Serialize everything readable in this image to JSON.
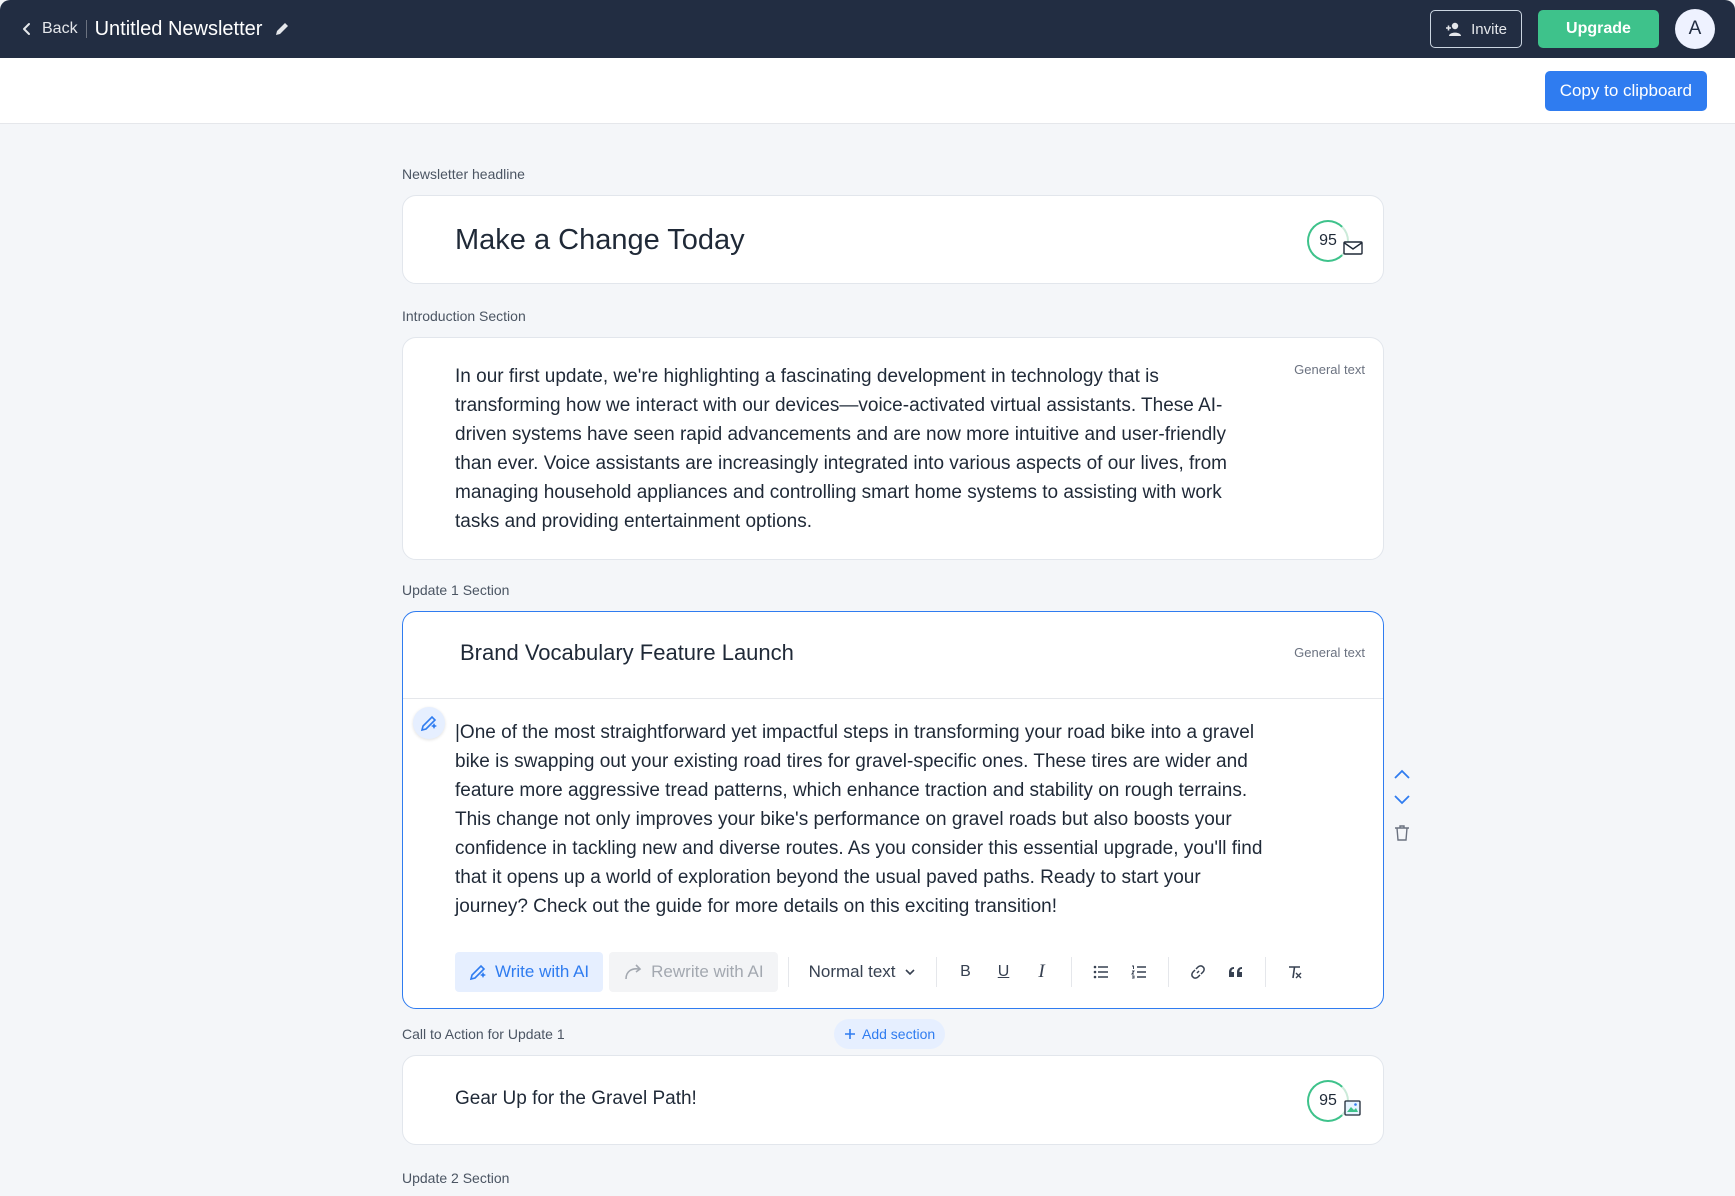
{
  "topbar": {
    "back_label": "Back",
    "doc_title": "Untitled Newsletter",
    "invite_label": "Invite",
    "upgrade_label": "Upgrade",
    "avatar_initial": "A"
  },
  "subbar": {
    "copy_label": "Copy to clipboard"
  },
  "headline": {
    "label": "Newsletter headline",
    "text": "Make a Change Today",
    "score": "95"
  },
  "intro": {
    "label": "Introduction Section",
    "tag": "General text",
    "body": "In our first update, we're highlighting a fascinating development in technology that is transforming how we interact with our devices—voice-activated virtual assistants. These AI-driven systems have seen rapid advancements and are now more intuitive and user-friendly than ever. Voice assistants are increasingly integrated into various aspects of our lives, from managing household appliances and controlling smart home systems to assisting with work tasks and providing entertainment options."
  },
  "update1": {
    "label": "Update 1 Section",
    "tag": "General text",
    "title": "Brand Vocabulary Feature Launch",
    "body": "|One of the most straightforward yet impactful steps in transforming your road bike into a gravel bike is swapping out your existing road tires for gravel-specific ones. These tires are wider and feature more aggressive tread patterns, which enhance traction and stability on rough terrains. This change not only improves your bike's performance on gravel roads but also boosts your confidence in tackling new and diverse routes. As you consider this essential upgrade, you'll find that it opens up a world of exploration beyond the usual paved paths. Ready to start your journey? Check out the guide for more details on this exciting transition!"
  },
  "toolbar": {
    "write_ai": "Write with AI",
    "rewrite_ai": "Rewrite with AI",
    "text_style": "Normal text",
    "bold": "B",
    "underline": "U",
    "italic": "I"
  },
  "cta": {
    "label": "Call to Action for Update 1",
    "add_section": "Add section",
    "text": "Gear Up for the Gravel Path!",
    "score": "95"
  },
  "update2": {
    "label": "Update 2 Section"
  },
  "colors": {
    "nav_bg": "#222d42",
    "accent_blue": "#2f7cf0",
    "accent_green": "#3ec28b"
  }
}
